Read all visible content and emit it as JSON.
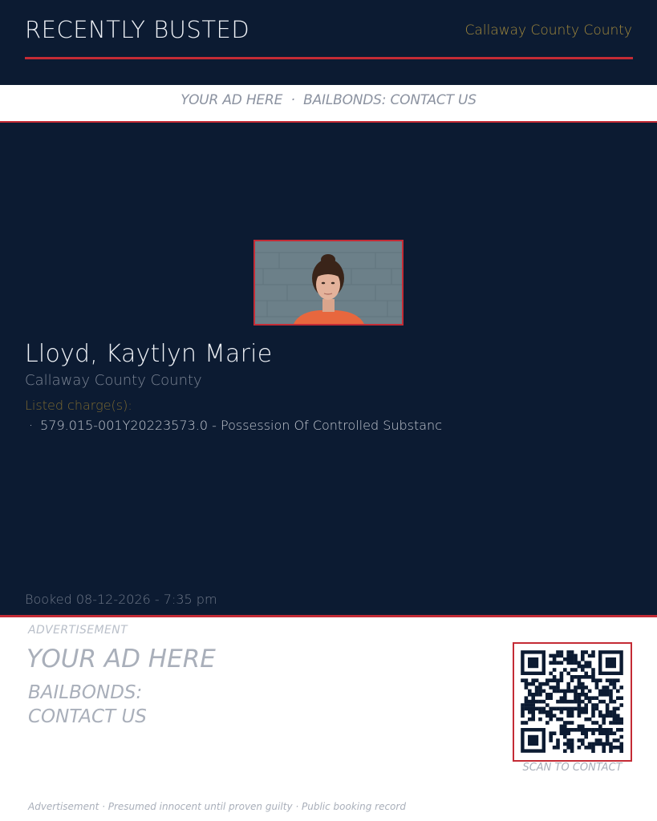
{
  "header": {
    "brand": "RECENTLY BUSTED",
    "county": "Callaway County County"
  },
  "ad_strip": {
    "text": "YOUR AD HERE  ·  BAILBONDS: CONTACT US"
  },
  "record": {
    "photo": "booking-mugshot",
    "name": "Lloyd, Kaytlyn Marie",
    "county": "Callaway County County",
    "charges_label": "Listed charge(s):",
    "charges": [
      "579.015-001Y20223573.0 - Possession Of Controlled Substanc"
    ],
    "bullet": "·",
    "booked": "Booked 08-12-2026 - 7:35 pm"
  },
  "advertisement": {
    "label": "ADVERTISEMENT",
    "headline": "YOUR AD HERE",
    "sub_line1": "BAILBONDS:",
    "sub_line2": "CONTACT US",
    "qr_icon": "qr-code-icon",
    "qr_caption": "SCAN TO CONTACT"
  },
  "footer": {
    "note": "Advertisement · Presumed innocent until proven guilty · Public booking record"
  },
  "colors": {
    "navy": "#0c1b32",
    "accent_red": "#c42b35",
    "gold": "#a58b3c",
    "muted_text": "#a9afba"
  }
}
